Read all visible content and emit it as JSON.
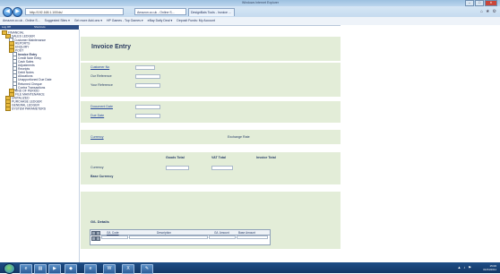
{
  "browser": {
    "window_title": "Windows Internet Explorer",
    "address": "http://192.168.1.100/ds/",
    "tabs": [
      {
        "label": "Amazon.co.uk - Online S..."
      },
      {
        "label": "DesignBais Tools - Invoice ..."
      }
    ],
    "favorites": [
      "Amazon.co.uk - Online S...",
      "Suggested Sites ▾",
      "Get more Add-ons ▾",
      "HP Games - Top Games ▾",
      "eBay Daily Deal ▾",
      "Deposit Funds: My Account"
    ]
  },
  "sidebar": {
    "header_left": "Log Off",
    "header_right": "Shortcuts",
    "items": [
      {
        "label": "FINANCIAL",
        "type": "folder"
      },
      {
        "label": "SALES LEDGER",
        "type": "folder"
      },
      {
        "label": "Customer Maintenance",
        "type": "doc"
      },
      {
        "label": "REPORTS",
        "type": "folder"
      },
      {
        "label": "ENQUIRY",
        "type": "folder"
      },
      {
        "label": "POST",
        "type": "folder"
      },
      {
        "label": "Invoice Entry",
        "type": "doc"
      },
      {
        "label": "Credit Note Entry",
        "type": "doc"
      },
      {
        "label": "Cash Sales",
        "type": "doc"
      },
      {
        "label": "Adjustments",
        "type": "doc"
      },
      {
        "label": "Receipts",
        "type": "doc"
      },
      {
        "label": "Debit Notes",
        "type": "doc"
      },
      {
        "label": "Allocations",
        "type": "doc"
      },
      {
        "label": "Unapportioned Due Date",
        "type": "doc"
      },
      {
        "label": "Returned Cheque",
        "type": "doc"
      },
      {
        "label": "Contra Transactions",
        "type": "doc"
      },
      {
        "label": "END OF PERIOD",
        "type": "folder"
      },
      {
        "label": "FILE MAINTENANCE",
        "type": "folder"
      },
      {
        "label": "UNITALIZED",
        "type": "folder"
      },
      {
        "label": "PURCHASE LEDGER",
        "type": "folder"
      },
      {
        "label": "GENERAL LEDGER",
        "type": "folder"
      },
      {
        "label": "SYSTEM PARAMETERS",
        "type": "folder"
      }
    ]
  },
  "form": {
    "title": "Invoice Entry",
    "customer_no": "Customer No",
    "our_reference": "Our Reference",
    "your_reference": "Your Reference",
    "document_date": "Document Date",
    "due_date": "Due Date",
    "currency_link": "Currency",
    "exchange_rate": "Exchange Rate",
    "goods_total": "Goods Total",
    "vat_total": "VAT Total",
    "invoice_total": "Invoice Total",
    "currency": "Currency",
    "base_currency": "Base Currency"
  },
  "gl": {
    "title": "G/L Details",
    "columns": [
      "G/L Code",
      "Description",
      "G/L Amount",
      "Base Amount"
    ]
  },
  "taskbar": {
    "time": "15:06",
    "date": "01/04/2011"
  },
  "colors": {
    "panel": "#e3edd8",
    "sidebar_header": "#2e4e86",
    "taskbar": "#1f4e86"
  }
}
